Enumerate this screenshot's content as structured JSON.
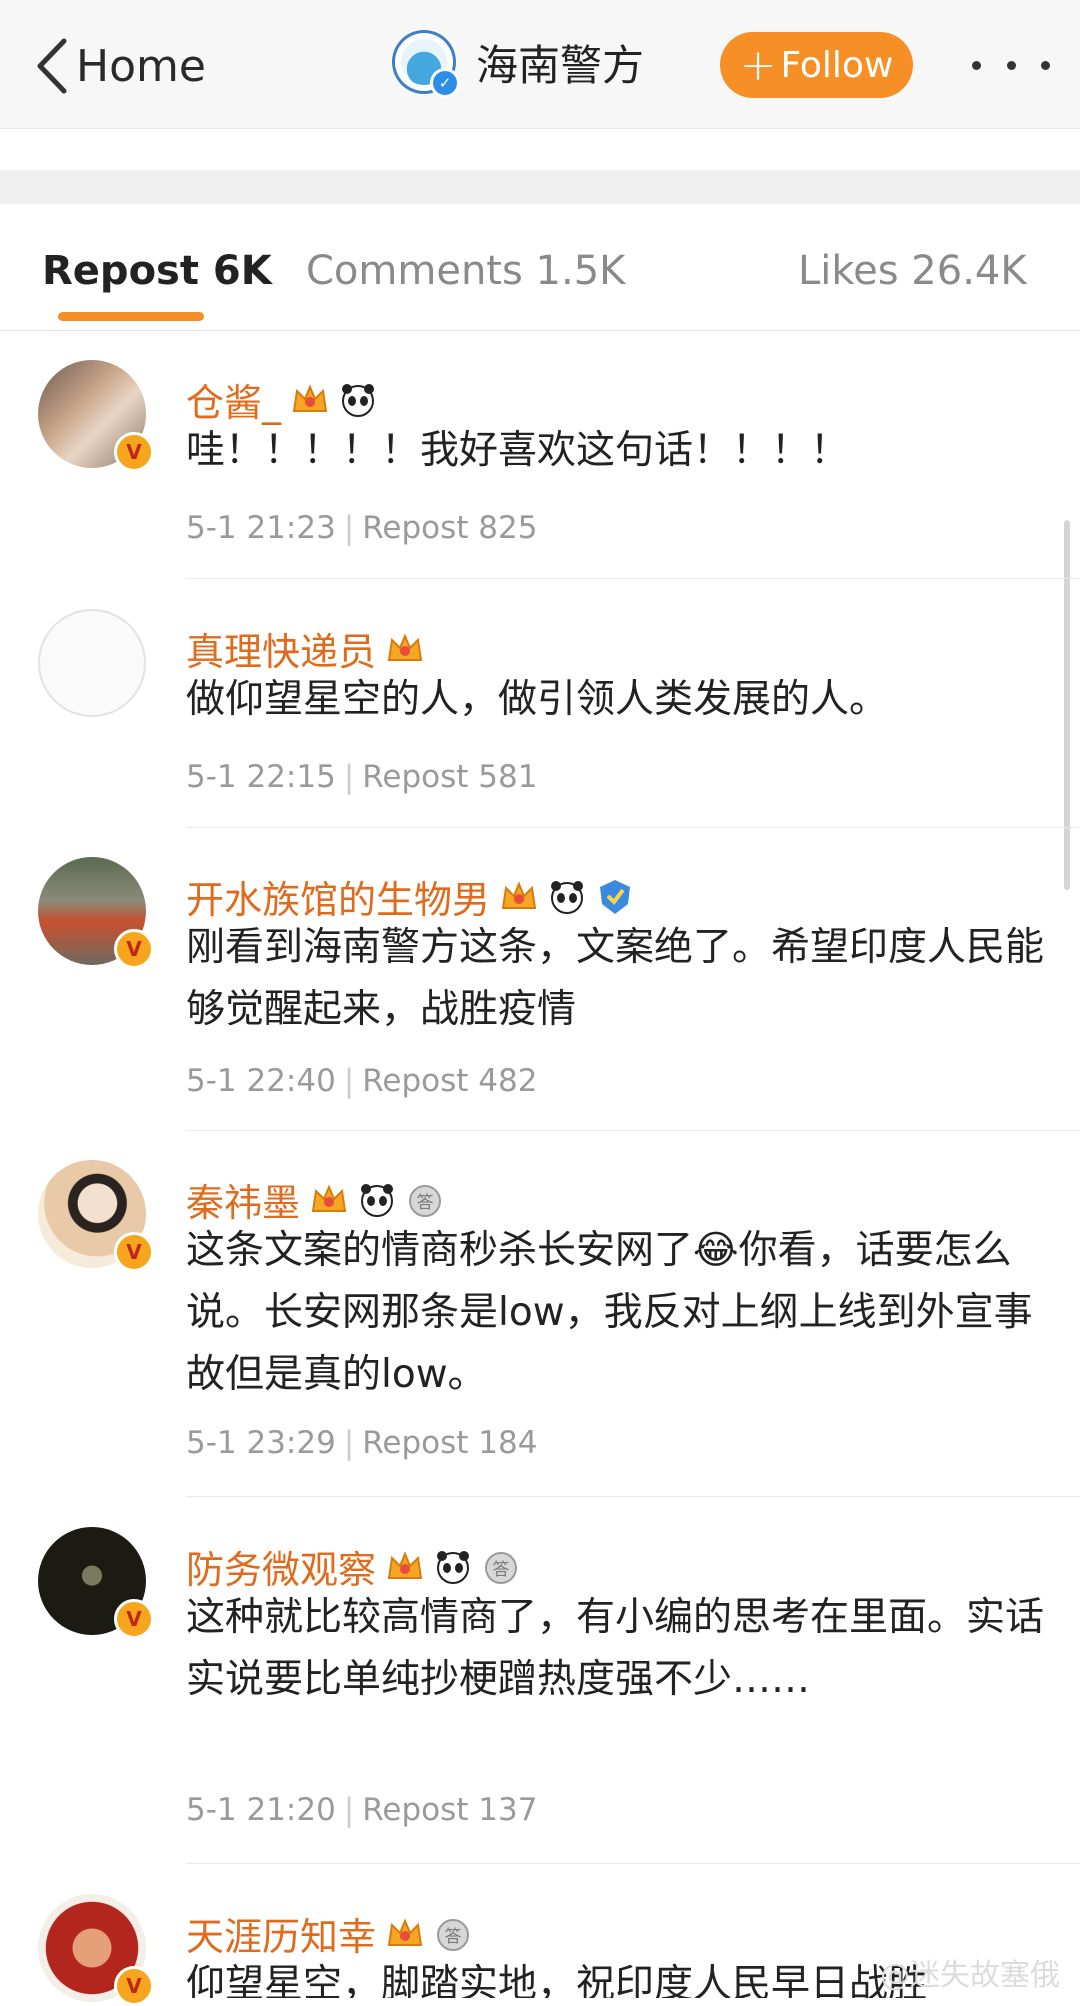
{
  "nav": {
    "back_label": "Home",
    "account_name": "海南警方",
    "follow_label": "Follow"
  },
  "tabs": [
    {
      "label": "Repost 6K",
      "active": true
    },
    {
      "label": "Comments 1.5K",
      "active": false
    },
    {
      "label": "Likes 26.4K",
      "active": false
    }
  ],
  "reposts": [
    {
      "name": "仓酱_",
      "text": "哇！！！！！我好喜欢这句话！！！！",
      "time": "5-1 21:23",
      "repost": "Repost 825",
      "badges": [
        "crown-badge-icon",
        "panda-badge-icon"
      ],
      "verified": true
    },
    {
      "name": "真理快递员",
      "text": "做仰望星空的人，做引领人类发展的人。",
      "time": "5-1 22:15",
      "repost": "Repost 581",
      "badges": [
        "crown-badge-icon"
      ],
      "verified": false
    },
    {
      "name": "开水族馆的生物男",
      "text": "刚看到海南警方这条，文案绝了。希望印度人民能够觉醒起来，战胜疫情",
      "time": "5-1 22:40",
      "repost": "Repost 482",
      "badges": [
        "crown-badge-icon",
        "panda-badge-icon",
        "shield-badge-icon"
      ],
      "verified": true
    },
    {
      "name": "秦祎墨",
      "text": "这条文案的情商秒杀长安网了😂你看，话要怎么说。长安网那条是low，我反对上纲上线到外宣事故但是真的low。",
      "time": "5-1 23:29",
      "repost": "Repost 184",
      "badges": [
        "crown-badge-icon",
        "panda-badge-icon",
        "answer-medal-icon"
      ],
      "verified": true
    },
    {
      "name": "防务微观察",
      "text": "这种就比较高情商了，有小编的思考在里面。实话实说要比单纯抄梗蹭热度强不少……",
      "time": "5-1 21:20",
      "repost": "Repost 137",
      "badges": [
        "crown-badge-icon",
        "panda-badge-icon",
        "answer-medal-icon"
      ],
      "verified": true
    },
    {
      "name": "天涯历知幸",
      "text": "仰望星空，脚踏实地，祝印度人民早日战胜",
      "time": "",
      "repost": "",
      "badges": [
        "crown-badge-icon",
        "answer-medal-icon"
      ],
      "verified": true
    }
  ],
  "watermark": "@迷失故塞俄",
  "colors": {
    "accent": "#f58f26",
    "username": "#e06b1c",
    "verified": "#f7a51c"
  }
}
